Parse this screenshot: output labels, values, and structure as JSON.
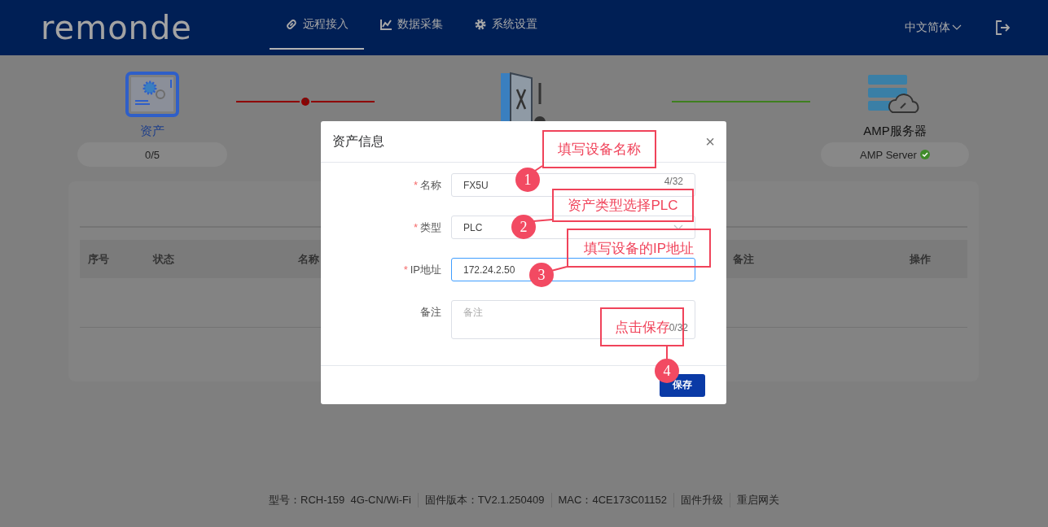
{
  "header": {
    "logo": "remonde",
    "nav": [
      {
        "label": "远程接入",
        "selected": true
      },
      {
        "label": "数据采集",
        "selected": false
      },
      {
        "label": "系统设置",
        "selected": false
      }
    ],
    "language": "中文简体"
  },
  "topology": {
    "asset": {
      "label": "资产",
      "count": "0/5"
    },
    "link_1": {
      "color": "#8e0000",
      "warning": true
    },
    "link_2": {
      "color": "#3f7f1f",
      "warning": false
    },
    "server": {
      "label": "AMP服务器",
      "status_text": "AMP Server",
      "online": true
    }
  },
  "table": {
    "columns": [
      "序号",
      "状态",
      "名称",
      "备注",
      "操作"
    ]
  },
  "dialog": {
    "title": "资产信息",
    "close": "×",
    "required_mark": "*",
    "fields": [
      {
        "kind": "text",
        "label": "名称",
        "required": true,
        "value": "FX5U",
        "counter": "4/32",
        "focused": false
      },
      {
        "kind": "select",
        "label": "类型",
        "required": true,
        "value": "PLC",
        "focused": false
      },
      {
        "kind": "text",
        "label": "IP地址",
        "required": true,
        "value": "172.24.2.50",
        "focused": true
      },
      {
        "kind": "textarea",
        "label": "备注",
        "required": false,
        "placeholder": "备注",
        "counter": "0/32",
        "focused": false
      }
    ],
    "save_button": "保存"
  },
  "annotations": [
    {
      "number": "1",
      "text": "填写设备名称"
    },
    {
      "number": "2",
      "text": "资产类型选择PLC"
    },
    {
      "number": "3",
      "text": "填写设备的IP地址"
    },
    {
      "number": "4",
      "text": "点击保存"
    }
  ],
  "footer": [
    {
      "kind": "text",
      "text": "型号：RCH-159  4G-CN/Wi-Fi"
    },
    {
      "kind": "text",
      "text": "固件版本：TV2.1.250409"
    },
    {
      "kind": "text",
      "text": "MAC：4CE173C01152"
    },
    {
      "kind": "link",
      "text": "固件升级"
    },
    {
      "kind": "link",
      "text": "重启网关"
    }
  ]
}
